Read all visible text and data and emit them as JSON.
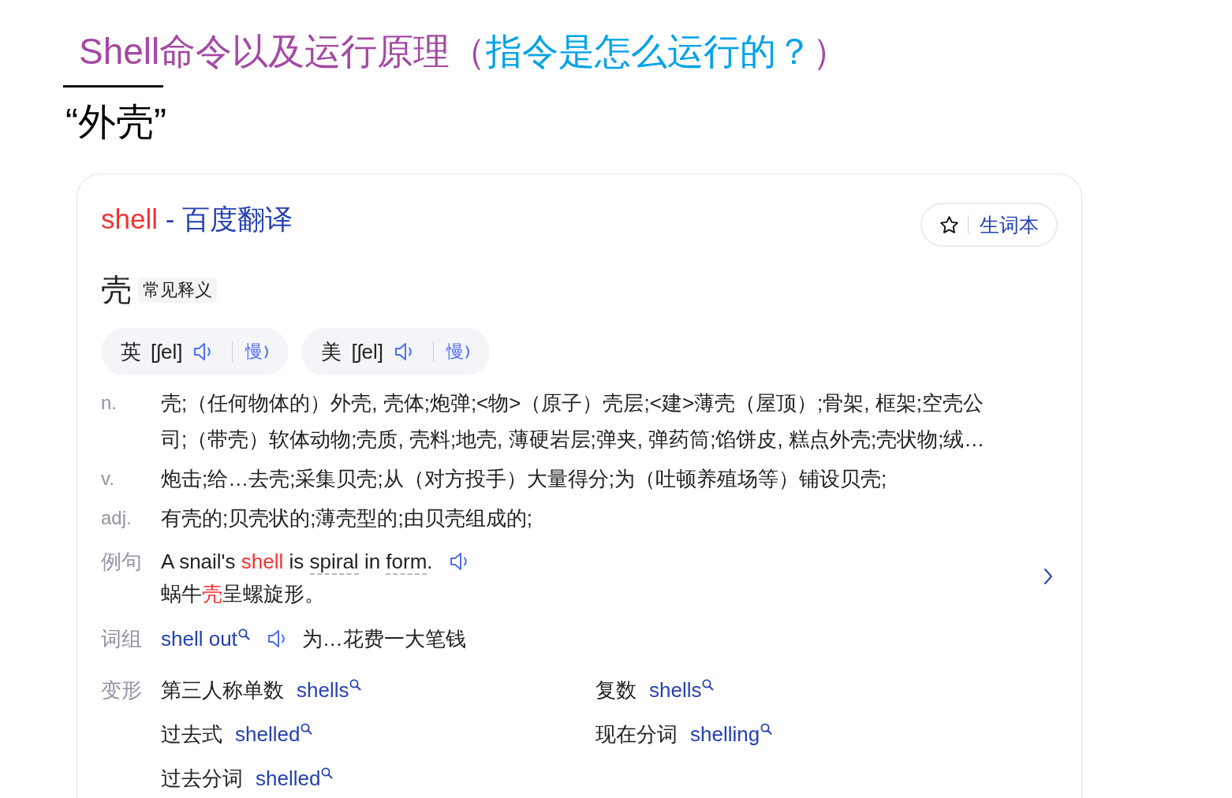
{
  "heading": {
    "segments": [
      {
        "text": "Shell命令以及运行原理（",
        "color": "#a349a4"
      },
      {
        "text": "指令是怎么运行的？",
        "color": "#00a2e8"
      },
      {
        "text": "）",
        "color": "#a349a4"
      }
    ]
  },
  "subheading": "“外壳”",
  "dictionary_card": {
    "title": {
      "word": "shell",
      "separator": "-",
      "source": "百度翻译"
    },
    "wordbook_button": {
      "label": "生词本"
    },
    "headword": "壳",
    "headword_tag": "常见释义",
    "pronunciations": [
      {
        "region": "英",
        "phonetic": "[ʃel]",
        "slow_label": "慢"
      },
      {
        "region": "美",
        "phonetic": "[ʃel]",
        "slow_label": "慢"
      }
    ],
    "definitions": [
      {
        "pos": "n.",
        "text": "壳;（任何物体的）外壳, 壳体;炮弹;<物>（原子）壳层;<建>薄壳（屋顶）;骨架, 框架;空壳公司;（带壳）软体动物;壳质, 壳料;地壳, 薄硬岩层;弹夹, 弹药筒;馅饼皮, 糕点外壳;壳状物;绒…"
      },
      {
        "pos": "v.",
        "text": "炮击;给…去壳;采集贝壳;从（对方投手）大量得分;为（吐顿养殖场等）铺设贝壳;"
      },
      {
        "pos": "adj.",
        "text": "有壳的;贝壳状的;薄壳型的;由贝壳组成的;"
      }
    ],
    "example": {
      "label": "例句",
      "sentence": [
        {
          "text": "A snail's ",
          "kind": "plain"
        },
        {
          "text": "shell",
          "kind": "highlight"
        },
        {
          "text": " is ",
          "kind": "plain"
        },
        {
          "text": "spiral",
          "kind": "lookup"
        },
        {
          "text": " in ",
          "kind": "plain"
        },
        {
          "text": "form",
          "kind": "lookup"
        },
        {
          "text": ".",
          "kind": "plain"
        }
      ],
      "translation": [
        {
          "text": "蜗牛",
          "kind": "plain"
        },
        {
          "text": "壳",
          "kind": "highlight"
        },
        {
          "text": "呈螺旋形。",
          "kind": "plain"
        }
      ]
    },
    "phrase": {
      "label": "词组",
      "term": "shell out",
      "meaning": "为…花费一大笔钱"
    },
    "forms": {
      "label": "变形",
      "items": [
        {
          "name": "第三人称单数",
          "word": "shells"
        },
        {
          "name": "复数",
          "word": "shells"
        },
        {
          "name": "过去式",
          "word": "shelled"
        },
        {
          "name": "现在分词",
          "word": "shelling"
        },
        {
          "name": "过去分词",
          "word": "shelled"
        }
      ]
    }
  }
}
